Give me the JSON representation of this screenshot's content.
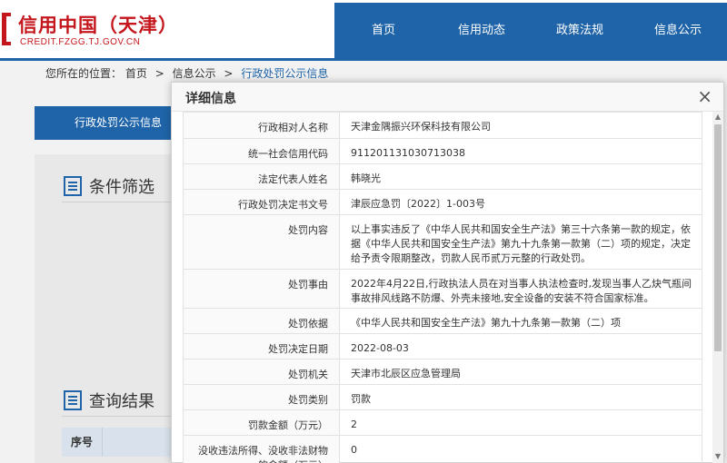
{
  "header": {
    "site_title": "信用中国（天津）",
    "site_url": "CREDIT.FZGG.TJ.GOV.CN",
    "nav": [
      "首页",
      "信用动态",
      "政策法规",
      "信息公示"
    ]
  },
  "breadcrumb": {
    "prefix": "您所在的位置：",
    "items": [
      "首页",
      "信息公示",
      "行政处罚公示信息"
    ],
    "separator": ">"
  },
  "background": {
    "side_tab": "行政处罚公示信息",
    "filter_title": "条件筛选",
    "result_title": "查询结果",
    "table_headers": [
      "序号"
    ]
  },
  "modal": {
    "title": "详细信息",
    "close": "×",
    "rows": [
      {
        "label": "行政相对人名称",
        "value": "天津金隅振兴环保科技有限公司"
      },
      {
        "label": "统一社会信用代码",
        "value": "911201131030713038"
      },
      {
        "label": "法定代表人姓名",
        "value": "韩晓光"
      },
      {
        "label": "行政处罚决定书文号",
        "value": "津辰应急罚〔2022〕1-003号"
      },
      {
        "label": "处罚内容",
        "value": "以上事实违反了《中华人民共和国安全生产法》第三十六条第一款的规定，依据《中华人民共和国安全生产法》第九十九条第一款第（二）项的规定，决定给予责令限期整改，罚款人民币贰万元整的行政处罚。"
      },
      {
        "label": "处罚事由",
        "value": "2022年4月22日,行政执法人员在对当事人执法检查时,发现当事人乙炔气瓶间事故排风线路不防爆、外壳未接地,安全设备的安装不符合国家标准。"
      },
      {
        "label": "处罚依据",
        "value": "《中华人民共和国安全生产法》第九十九条第一款第（二）项"
      },
      {
        "label": "处罚决定日期",
        "value": "2022-08-03"
      },
      {
        "label": "处罚机关",
        "value": "天津市北辰区应急管理局"
      },
      {
        "label": "处罚类别",
        "value": "罚款"
      },
      {
        "label": "罚款金额（万元）",
        "value": "2"
      },
      {
        "label": "没收违法所得、没收非法财物的金额（万元）",
        "value": "0"
      }
    ]
  },
  "colors": {
    "brand_red": "#c4161c",
    "nav_blue": "#1f64a8"
  }
}
